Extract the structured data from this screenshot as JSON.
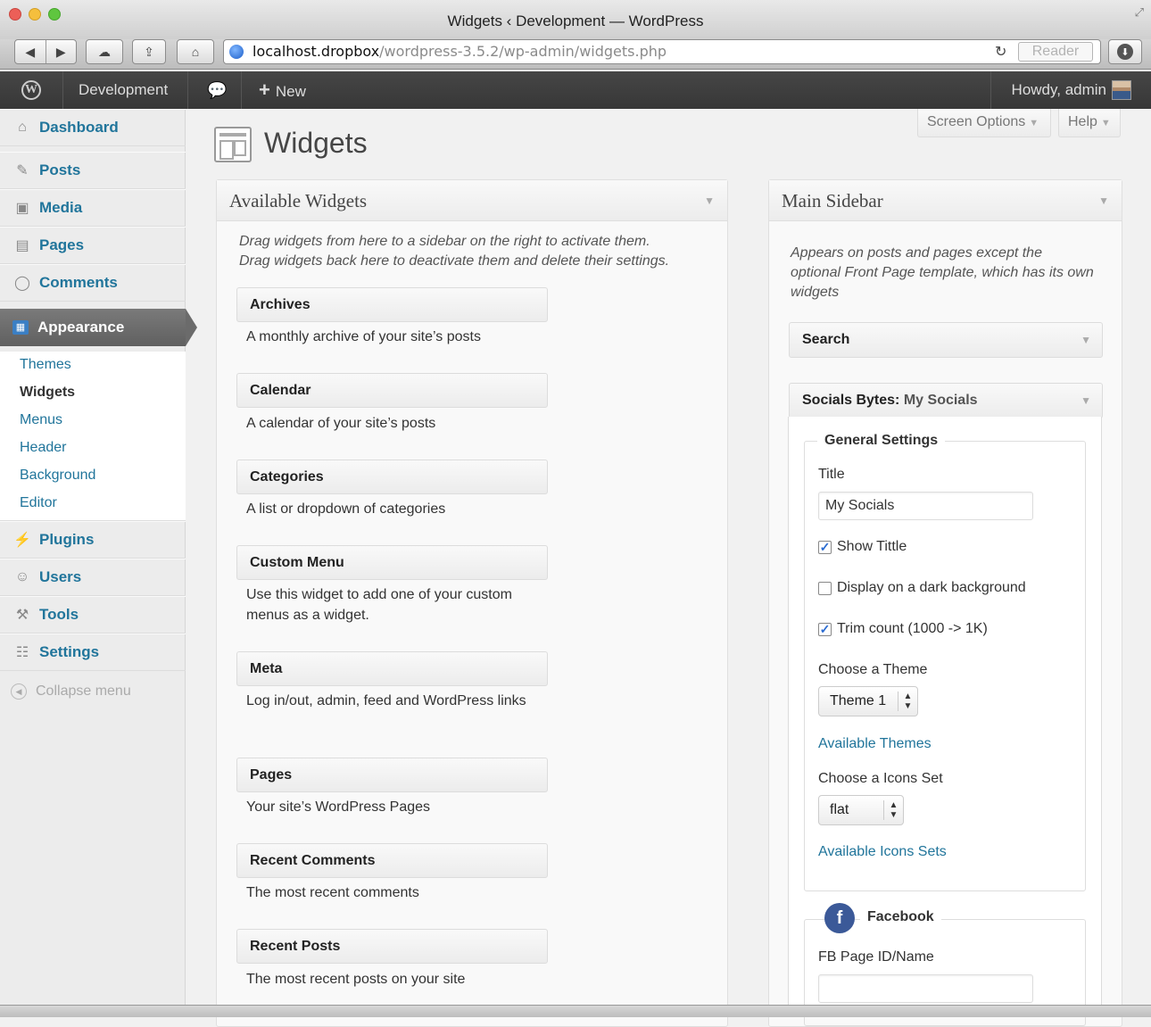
{
  "browser": {
    "window_title": "Widgets ‹ Development — WordPress",
    "url_host": "localhost.dropbox",
    "url_path": "/wordpress-3.5.2/wp-admin/widgets.php",
    "reader_label": "Reader"
  },
  "adminbar": {
    "site_name": "Development",
    "new_label": "New",
    "howdy": "Howdy, admin"
  },
  "menu": {
    "items": [
      {
        "label": "Dashboard",
        "icon": "home-icon"
      },
      {
        "label": "Posts",
        "icon": "pushpin-icon"
      },
      {
        "label": "Media",
        "icon": "camera-icon"
      },
      {
        "label": "Pages",
        "icon": "pages-icon"
      },
      {
        "label": "Comments",
        "icon": "comment-icon"
      },
      {
        "label": "Appearance",
        "icon": "appearance-icon"
      },
      {
        "label": "Plugins",
        "icon": "plug-icon"
      },
      {
        "label": "Users",
        "icon": "users-icon"
      },
      {
        "label": "Tools",
        "icon": "tools-icon"
      },
      {
        "label": "Settings",
        "icon": "settings-icon"
      }
    ],
    "submenu": [
      "Themes",
      "Widgets",
      "Menus",
      "Header",
      "Background",
      "Editor"
    ],
    "collapse_label": "Collapse menu"
  },
  "header": {
    "screen_options": "Screen Options",
    "help": "Help",
    "page_title": "Widgets"
  },
  "available_widgets": {
    "title": "Available Widgets",
    "description_line1": "Drag widgets from here to a sidebar on the right to activate them.",
    "description_line2": "Drag widgets back here to deactivate them and delete their settings.",
    "widgets": [
      {
        "name": "Archives",
        "desc": "A monthly archive of your site’s posts"
      },
      {
        "name": "Calendar",
        "desc": "A calendar of your site’s posts"
      },
      {
        "name": "Categories",
        "desc": "A list or dropdown of categories"
      },
      {
        "name": "Custom Menu",
        "desc": "Use this widget to add one of your custom menus as a widget."
      },
      {
        "name": "Meta",
        "desc": "Log in/out, admin, feed and WordPress links"
      },
      {
        "name": "Pages",
        "desc": "Your site’s WordPress Pages"
      },
      {
        "name": "Recent Comments",
        "desc": "The most recent comments"
      },
      {
        "name": "Recent Posts",
        "desc": "The most recent posts on your site"
      }
    ]
  },
  "main_sidebar": {
    "title": "Main Sidebar",
    "description": "Appears on posts and pages except the optional Front Page template, which has its own widgets",
    "search_widget": "Search",
    "socials_widget": "Socials Bytes:",
    "socials_instance": "My Socials",
    "general_settings": "General Settings",
    "title_label": "Title",
    "title_value": "My Socials",
    "show_title": "Show Tittle",
    "dark_bg": "Display on a dark background",
    "trim_count": "Trim count (1000 -> 1K)",
    "choose_theme": "Choose a Theme",
    "theme_value": "Theme 1",
    "available_themes": "Available Themes",
    "choose_icons": "Choose a Icons Set",
    "icons_value": "flat",
    "available_icons": "Available Icons Sets",
    "facebook": "Facebook",
    "fb_label": "FB Page ID/Name",
    "fb_value": ""
  }
}
